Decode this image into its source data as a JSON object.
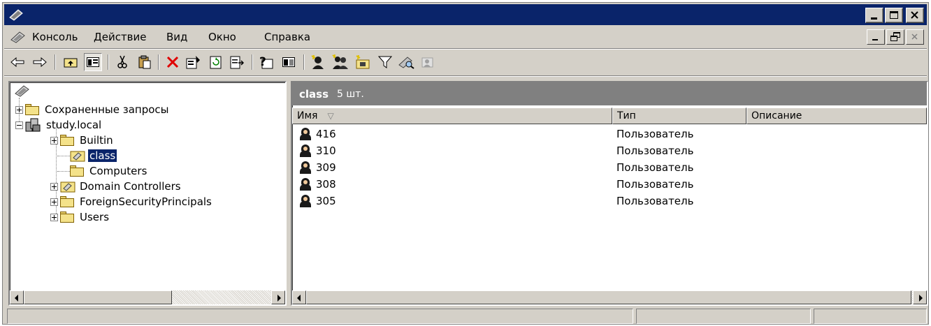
{
  "window": {
    "title": ""
  },
  "menu": {
    "items": [
      "Консоль",
      "Действие",
      "Вид",
      "Окно",
      "Справка"
    ]
  },
  "toolbar": {
    "buttons": [
      "back-arrow",
      "forward-arrow",
      "up-one-level",
      "show-hide-tree",
      "cut",
      "paste",
      "delete",
      "properties",
      "refresh",
      "export-list",
      "help",
      "show-hide-description",
      "new-user",
      "new-group",
      "new-ou",
      "filter",
      "find",
      "add-to-group"
    ]
  },
  "tree": {
    "root_label": "",
    "items": [
      {
        "label": "Сохраненные запросы",
        "expander": "plus"
      },
      {
        "label": "study.local",
        "expander": "minus"
      },
      {
        "label": "Builtin",
        "expander": "plus"
      },
      {
        "label": "class",
        "expander": "none",
        "selected": true
      },
      {
        "label": "Computers",
        "expander": "none"
      },
      {
        "label": "Domain Controllers",
        "expander": "plus"
      },
      {
        "label": "ForeignSecurityPrincipals",
        "expander": "plus"
      },
      {
        "label": "Users",
        "expander": "plus"
      }
    ]
  },
  "results": {
    "title": "class",
    "count": "5 шт.",
    "columns": [
      "Имя",
      "Тип",
      "Описание"
    ],
    "sort_indicator": "▽",
    "rows": [
      {
        "name": "416",
        "type": "Пользователь",
        "description": ""
      },
      {
        "name": "310",
        "type": "Пользователь",
        "description": ""
      },
      {
        "name": "309",
        "type": "Пользователь",
        "description": ""
      },
      {
        "name": "308",
        "type": "Пользователь",
        "description": ""
      },
      {
        "name": "305",
        "type": "Пользователь",
        "description": ""
      }
    ]
  },
  "status": {
    "panels": [
      "",
      "",
      ""
    ]
  },
  "colors": {
    "title_bar": "#0a246a",
    "chrome": "#d4d0c8",
    "results_header": "#808080",
    "selection": "#0a246a"
  }
}
